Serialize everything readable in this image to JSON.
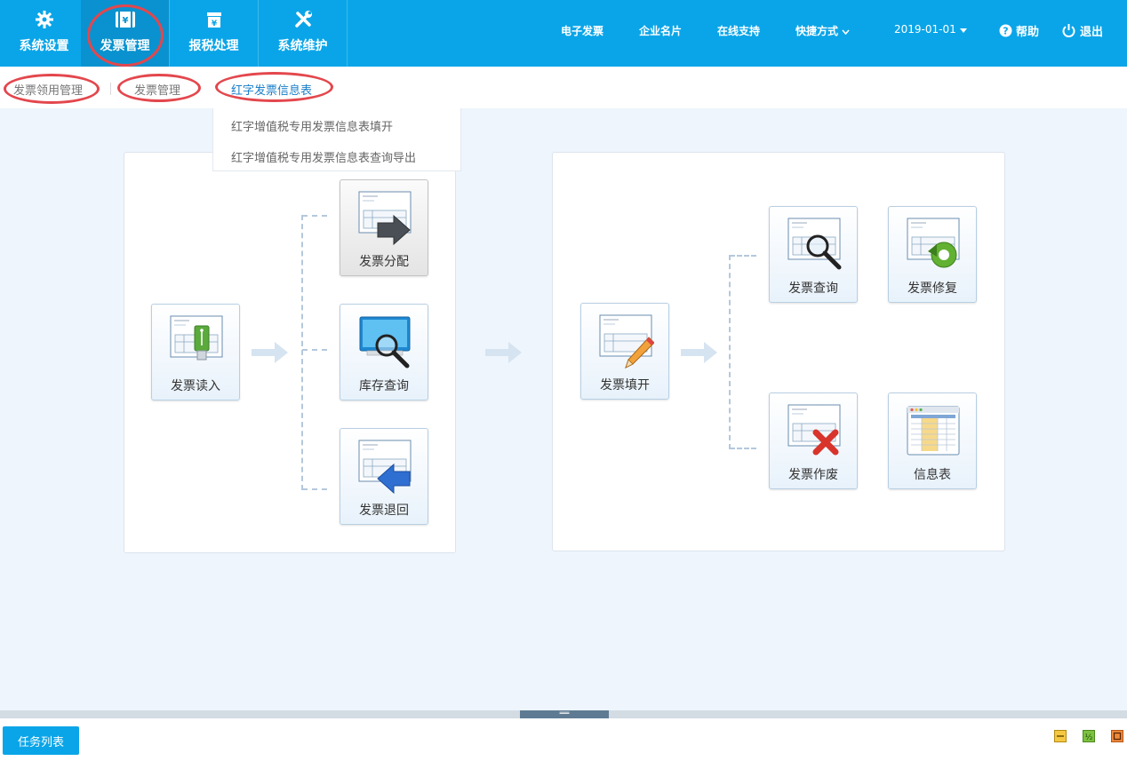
{
  "modules": [
    {
      "label": "系统设置",
      "icon": "gear-icon"
    },
    {
      "label": "发票管理",
      "icon": "invoice-icon"
    },
    {
      "label": "报税处理",
      "icon": "tax-icon"
    },
    {
      "label": "系统维护",
      "icon": "tools-icon"
    }
  ],
  "topnav": {
    "einvoice": "电子发票",
    "card": "企业名片",
    "support": "在线支持",
    "shortcut": "快捷方式",
    "date": "2019-01-01",
    "help": "帮助",
    "logout": "退出"
  },
  "subnav": {
    "item1": "发票领用管理",
    "item2": "发票管理",
    "item3": "红字发票信息表"
  },
  "dropdown": {
    "item1": "红字增值税专用发票信息表填开",
    "item2": "红字增值税专用发票信息表查询导出"
  },
  "flow": {
    "read": "发票读入",
    "distribute": "发票分配",
    "stock": "库存查询",
    "return": "发票退回",
    "fill": "发票填开",
    "query": "发票查询",
    "repair": "发票修复",
    "void": "发票作废",
    "info": "信息表"
  },
  "footer": {
    "tasklist": "任务列表"
  },
  "colors": {
    "brand": "#0aa5e8",
    "active_module": "#0992cf",
    "annotation_red": "#e3474d"
  }
}
